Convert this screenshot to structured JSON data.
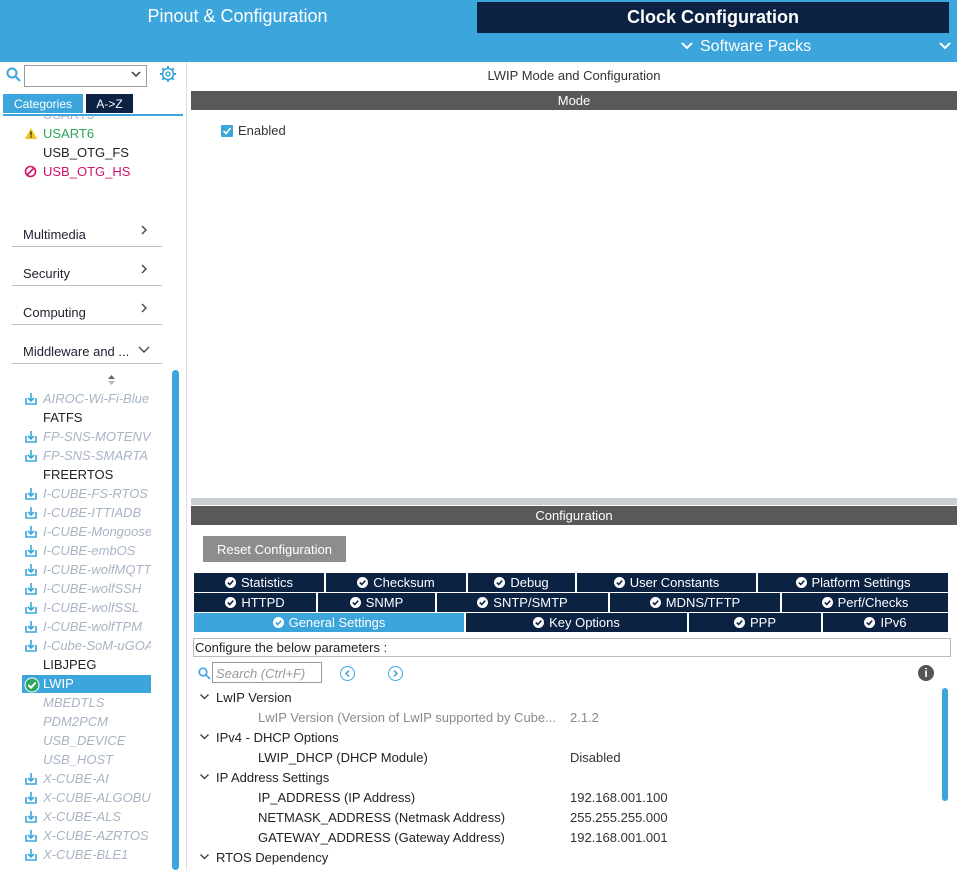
{
  "header": {
    "tab_pinout": "Pinout & Configuration",
    "tab_clock": "Clock Configuration",
    "software_packs": "Software Packs"
  },
  "left": {
    "tabs": {
      "categories": "Categories",
      "az": "A->Z"
    },
    "peripherals": [
      {
        "label": "USART6",
        "state": "warning"
      },
      {
        "label": "USB_OTG_FS",
        "state": "normal"
      },
      {
        "label": "USB_OTG_HS",
        "state": "error"
      }
    ],
    "categories": [
      {
        "label": "Multimedia",
        "expanded": false
      },
      {
        "label": "Security",
        "expanded": false
      },
      {
        "label": "Computing",
        "expanded": false
      },
      {
        "label": "Middleware and ...",
        "expanded": true
      }
    ],
    "middleware": [
      {
        "label": "AIROC-Wi-Fi-Blue",
        "style": "pack"
      },
      {
        "label": "FATFS",
        "style": "dark"
      },
      {
        "label": "FP-SNS-MOTENV",
        "style": "pack"
      },
      {
        "label": "FP-SNS-SMARTA",
        "style": "pack"
      },
      {
        "label": "FREERTOS",
        "style": "dark"
      },
      {
        "label": "I-CUBE-FS-RTOS",
        "style": "pack"
      },
      {
        "label": "I-CUBE-ITTIADB",
        "style": "pack"
      },
      {
        "label": "I-CUBE-Mongoose",
        "style": "pack"
      },
      {
        "label": "I-CUBE-embOS",
        "style": "pack"
      },
      {
        "label": "I-CUBE-wolfMQTT",
        "style": "pack"
      },
      {
        "label": "I-CUBE-wolfSSH",
        "style": "pack"
      },
      {
        "label": "I-CUBE-wolfSSL",
        "style": "pack"
      },
      {
        "label": "I-CUBE-wolfTPM",
        "style": "pack"
      },
      {
        "label": "I-Cube-SoM-uGOA",
        "style": "pack"
      },
      {
        "label": "LIBJPEG",
        "style": "dark"
      },
      {
        "label": "LWIP",
        "style": "selected"
      },
      {
        "label": "MBEDTLS",
        "style": "disabled"
      },
      {
        "label": "PDM2PCM",
        "style": "disabled"
      },
      {
        "label": "USB_DEVICE",
        "style": "disabled"
      },
      {
        "label": "USB_HOST",
        "style": "disabled"
      },
      {
        "label": "X-CUBE-AI",
        "style": "pack"
      },
      {
        "label": "X-CUBE-ALGOBU",
        "style": "pack"
      },
      {
        "label": "X-CUBE-ALS",
        "style": "pack"
      },
      {
        "label": "X-CUBE-AZRTOS",
        "style": "pack"
      },
      {
        "label": "X-CUBE-BLE1",
        "style": "pack"
      }
    ]
  },
  "right": {
    "title": "LWIP Mode and Configuration",
    "mode_header": "Mode",
    "enabled_label": "Enabled",
    "enabled_checked": true,
    "config_header": "Configuration",
    "reset_label": "Reset Configuration",
    "tabs_row1": [
      "Statistics",
      "Checksum",
      "Debug",
      "User Constants",
      "Platform Settings"
    ],
    "tabs_row2": [
      "HTTPD",
      "SNMP",
      "SNTP/SMTP",
      "MDNS/TFTP",
      "Perf/Checks"
    ],
    "tabs_row3": [
      "General Settings",
      "Key Options",
      "PPP",
      "IPv6"
    ],
    "active_tab": "General Settings",
    "configure_label": "Configure the below parameters :",
    "search_placeholder": "Search (Ctrl+F)",
    "tree": [
      {
        "type": "group",
        "label": "LwIP Version"
      },
      {
        "type": "param",
        "label": "LwIP Version (Version of LwIP supported by Cube...",
        "value": "2.1.2",
        "dim": true
      },
      {
        "type": "group",
        "label": "IPv4 - DHCP Options"
      },
      {
        "type": "param",
        "label": "LWIP_DHCP (DHCP Module)",
        "value": "Disabled",
        "dim": false
      },
      {
        "type": "group",
        "label": "IP Address Settings"
      },
      {
        "type": "param",
        "label": "IP_ADDRESS (IP Address)",
        "value": "192.168.001.100",
        "dim": false
      },
      {
        "type": "param",
        "label": "NETMASK_ADDRESS (Netmask Address)",
        "value": "255.255.255.000",
        "dim": false
      },
      {
        "type": "param",
        "label": "GATEWAY_ADDRESS (Gateway Address)",
        "value": "192.168.001.001",
        "dim": false
      },
      {
        "type": "group",
        "label": "RTOS Dependency"
      }
    ]
  },
  "colors": {
    "accent": "#3ba5dc",
    "navy": "#0b2243",
    "warning": "#f0c419",
    "error": "#d0116a",
    "ok": "#2ca55e"
  }
}
